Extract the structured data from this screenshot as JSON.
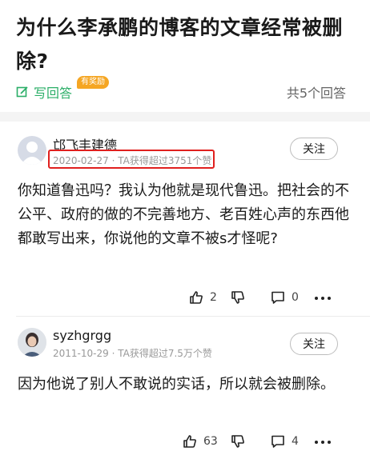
{
  "question": {
    "title": "为什么李承鹏的博客的文章经常被删除?",
    "write_answer_label": "写回答",
    "reward_badge": "有奖励",
    "answer_count": "共5个回答"
  },
  "answers": [
    {
      "author": "邙飞丰建德",
      "date": "2020-02-27",
      "meta_sep": "·",
      "likes_info": "TA获得超过3751个赞",
      "follow_label": "关注",
      "text": "你知道鲁迅吗？我认为他就是现代鲁迅。把社会的不公平、政府的做的不完善地方、老百姓心声的东西他都敢写出来，你说他的文章不被s才怪呢?",
      "upvotes": "2",
      "comments": "0"
    },
    {
      "author": "syzhgrgg",
      "date": "2011-10-29",
      "meta_sep": "·",
      "likes_info": "TA获得超过7.5万个赞",
      "follow_label": "关注",
      "text": "因为他说了别人不敢说的实话，所以就会被删除。",
      "upvotes": "63",
      "comments": "4"
    }
  ],
  "colors": {
    "accent_green": "#2aae67",
    "badge_orange": "#f5a623",
    "highlight_red": "#e0201e"
  }
}
